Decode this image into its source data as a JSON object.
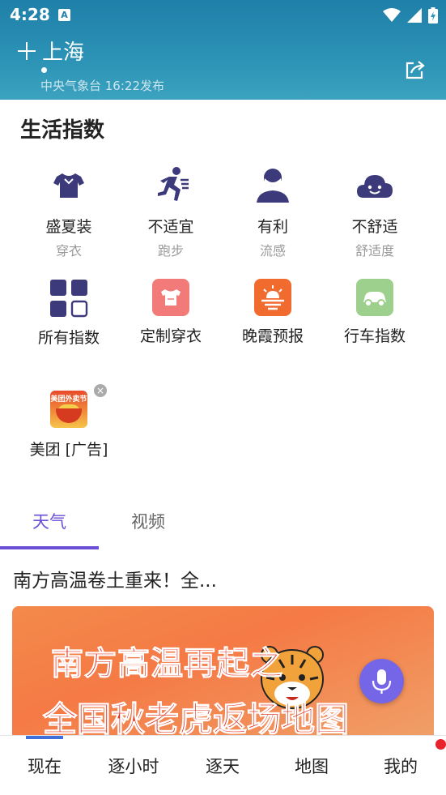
{
  "status_bar": {
    "time": "4:28",
    "notification_icon": "A"
  },
  "header": {
    "city": "上海",
    "publish_info": "中央气象台 16:22发布"
  },
  "life_index": {
    "title": "生活指数",
    "items": [
      {
        "value": "盛夏装",
        "label": "穿衣",
        "icon": "shirt-icon"
      },
      {
        "value": "不适宜",
        "label": "跑步",
        "icon": "running-icon"
      },
      {
        "value": "有利",
        "label": "流感",
        "icon": "mask-person-icon"
      },
      {
        "value": "不舒适",
        "label": "舒适度",
        "icon": "cloud-face-icon"
      }
    ],
    "tools": [
      {
        "label": "所有指数",
        "icon": "grid-icon"
      },
      {
        "label": "定制穿衣",
        "icon": "custom-clothes-icon",
        "color": "#f27a78"
      },
      {
        "label": "晚霞预报",
        "icon": "sunset-icon",
        "color": "#f26b2e"
      },
      {
        "label": "行车指数",
        "icon": "car-icon",
        "color": "#9dd08c"
      }
    ]
  },
  "ad": {
    "label": "美团 [广告]",
    "image_text": "美团外卖节"
  },
  "tabs": [
    {
      "label": "天气",
      "active": true
    },
    {
      "label": "视频",
      "active": false
    }
  ],
  "news": {
    "title": "南方高温卷土重来！全...",
    "banner_line1": "南方高温再起之",
    "banner_line2": "全国秋老虎返场地图"
  },
  "bottom_nav": [
    {
      "label": "现在",
      "active": true
    },
    {
      "label": "逐小时"
    },
    {
      "label": "逐天"
    },
    {
      "label": "地图"
    },
    {
      "label": "我的",
      "badge": true
    }
  ],
  "colors": {
    "accent": "#6b4fd6",
    "header": "#2c93b6",
    "icon_navy": "#3c3a7a"
  }
}
